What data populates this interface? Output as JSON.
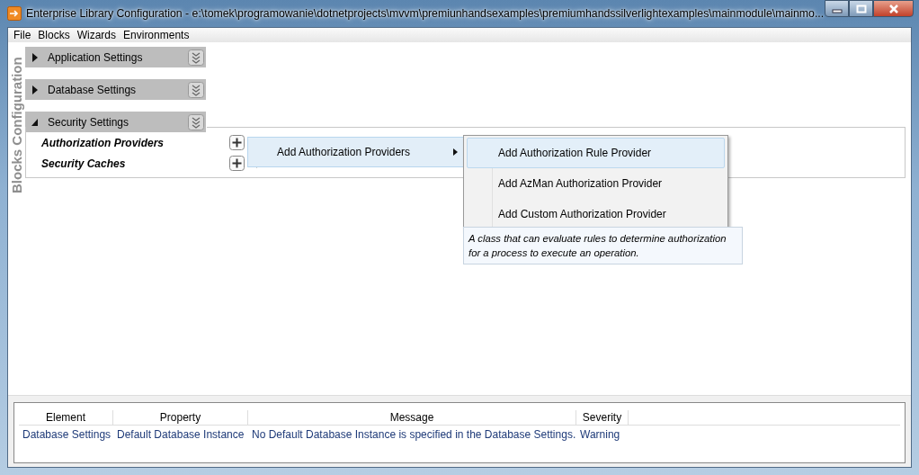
{
  "window": {
    "title": "Enterprise Library Configuration - e:\\tomek\\programowanie\\dotnetprojects\\mvvm\\premiunhandsexamples\\premiumhandssilverlightexamples\\mainmodule\\mainmo..."
  },
  "menu_bar": [
    "File",
    "Blocks",
    "Wizards",
    "Environments"
  ],
  "side_label": "Blocks Configuration",
  "sections": [
    {
      "title": "Application Settings",
      "expanded": false
    },
    {
      "title": "Database Settings",
      "expanded": false
    },
    {
      "title": "Security Settings",
      "expanded": true,
      "items": [
        "Authorization Providers",
        "Security Caches"
      ]
    }
  ],
  "context_menu": {
    "items": [
      {
        "label": "Add Authorization Providers",
        "selected": true
      }
    ]
  },
  "submenu": {
    "items": [
      {
        "label": "Add Authorization Rule Provider",
        "selected": true
      },
      {
        "label": "Add AzMan Authorization Provider",
        "selected": false
      },
      {
        "label": "Add Custom Authorization Provider",
        "selected": false
      }
    ]
  },
  "tooltip": "A class that can evaluate rules to determine authorization for a process to execute an operation.",
  "validation": {
    "columns": [
      "Element",
      "Property",
      "Message",
      "Severity"
    ],
    "rows": [
      [
        "Database Settings",
        "Default Database Instance",
        "No Default Database Instance is specified in the Database Settings.",
        "Warning"
      ]
    ]
  }
}
